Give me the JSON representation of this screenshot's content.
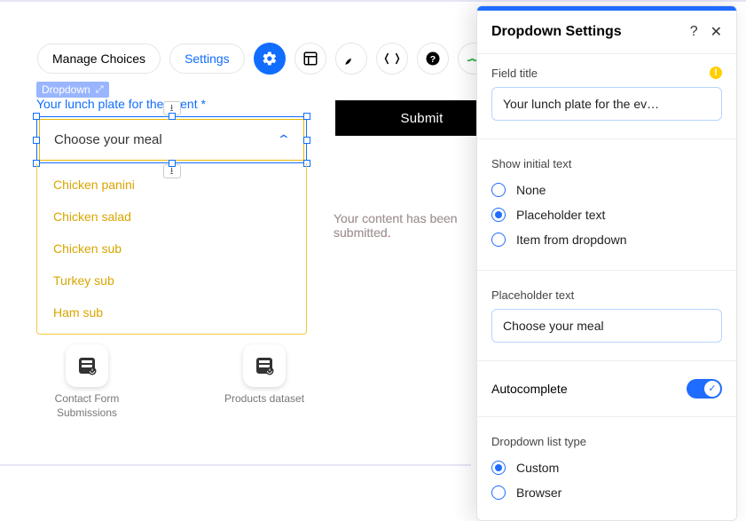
{
  "toolbar": {
    "manage_choices": "Manage Choices",
    "settings": "Settings"
  },
  "element_tag": "Dropdown",
  "field": {
    "title": "Your lunch plate for the event *",
    "placeholder": "Choose your meal",
    "options": [
      "Chicken panini",
      "Chicken salad",
      "Chicken sub",
      "Turkey sub",
      "Ham sub"
    ]
  },
  "submit_label": "Submit",
  "message_red": "Your content has been submitted.",
  "message_grey": "Your content has been submitted",
  "datasets": [
    {
      "label": "Contact Form Submissions"
    },
    {
      "label": "Products dataset"
    }
  ],
  "panel": {
    "title": "Dropdown Settings",
    "field_title_label": "Field title",
    "field_title_value": "Your lunch plate for the ev…",
    "show_initial_text_label": "Show initial text",
    "show_initial_options": {
      "none": "None",
      "placeholder": "Placeholder text",
      "item": "Item from dropdown"
    },
    "show_initial_selected": "placeholder",
    "placeholder_label": "Placeholder text",
    "placeholder_value": "Choose your meal",
    "autocomplete_label": "Autocomplete",
    "autocomplete_on": true,
    "list_type_label": "Dropdown list type",
    "list_types": {
      "custom": "Custom",
      "browser": "Browser"
    },
    "list_type_selected": "custom"
  }
}
